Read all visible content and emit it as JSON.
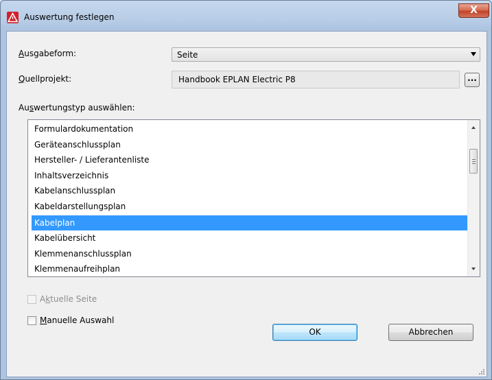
{
  "window": {
    "title": "Auswertung festlegen",
    "close_label": "X"
  },
  "form": {
    "ausgabeform": {
      "label_prefix": "A",
      "label_rest": "usgabeform:",
      "value": "Seite"
    },
    "quellprojekt": {
      "label_prefix": "Q",
      "label_rest": "uellprojekt:",
      "value": "Handbook EPLAN Electric P8",
      "browse_label": "..."
    },
    "auswertungstyp": {
      "label_before": "Au",
      "label_u": "s",
      "label_after": "wertungstyp auswählen:"
    }
  },
  "list": {
    "items": [
      "Formulardokumentation",
      "Geräteanschlussplan",
      "Hersteller- / Lieferantenliste",
      "Inhaltsverzeichnis",
      "Kabelanschlussplan",
      "Kabeldarstellungsplan",
      "Kabelplan",
      "Kabelübersicht",
      "Klemmenanschlussplan",
      "Klemmenaufreihplan"
    ],
    "selected": "Kabelplan"
  },
  "options": {
    "aktuelle_seite": {
      "before": "A",
      "u": "k",
      "after": "tuelle Seite",
      "checked": false,
      "enabled": false
    },
    "manuelle_auswahl": {
      "before": "",
      "u": "M",
      "after": "anuelle Auswahl",
      "checked": false,
      "enabled": true
    }
  },
  "buttons": {
    "ok": "OK",
    "cancel": "Abbrechen"
  },
  "colors": {
    "selection": "#3399ff",
    "close_button": "#c0442a",
    "title_bar": "#b8cde6"
  }
}
